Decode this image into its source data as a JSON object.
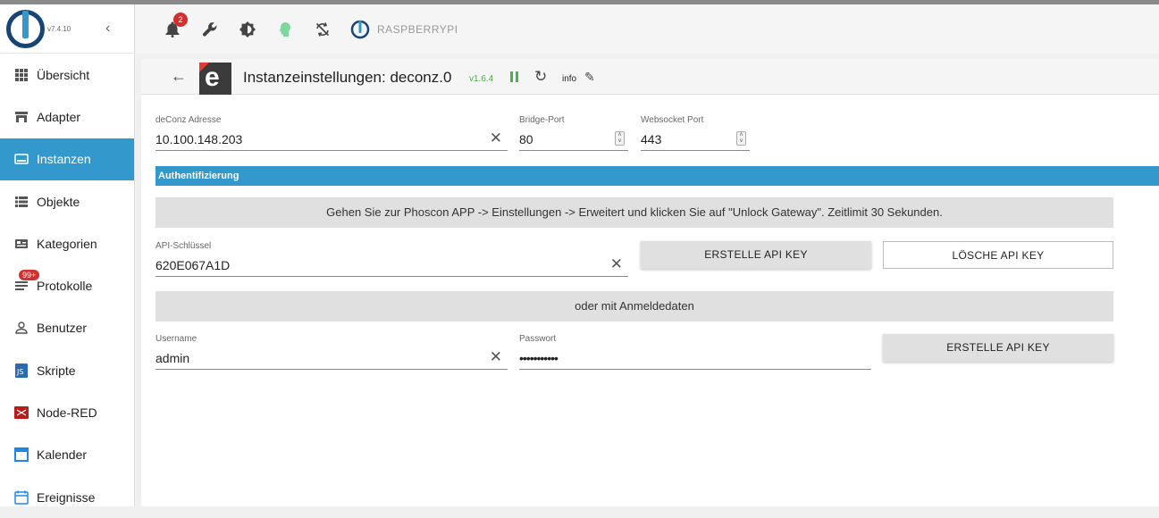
{
  "sidebar": {
    "version": "v7.4.10",
    "items": [
      {
        "label": "Übersicht"
      },
      {
        "label": "Adapter"
      },
      {
        "label": "Instanzen"
      },
      {
        "label": "Objekte"
      },
      {
        "label": "Kategorien"
      },
      {
        "label": "Protokolle",
        "badge": "99+"
      },
      {
        "label": "Benutzer"
      },
      {
        "label": "Skripte"
      },
      {
        "label": "Node-RED"
      },
      {
        "label": "Kalender"
      },
      {
        "label": "Ereignisse"
      }
    ]
  },
  "topbar": {
    "notification_count": "2",
    "host": "RASPBERRYPI"
  },
  "header": {
    "title": "Instanzeinstellungen: deconz.0",
    "version": "v1.6.4",
    "info": "info"
  },
  "form": {
    "address": {
      "label": "deConz Adresse",
      "value": "10.100.148.203"
    },
    "bridge_port": {
      "label": "Bridge-Port",
      "value": "80"
    },
    "websocket_port": {
      "label": "Websocket Port",
      "value": "443"
    },
    "section_title": "Authentifizierung",
    "notice": "Gehen Sie zur Phoscon APP -> Einstellungen -> Erweitert und klicken Sie auf \"Unlock Gateway\". Zeitlimit 30 Sekunden.",
    "api_key": {
      "label": "API-Schlüssel",
      "value": "620E067A1D"
    },
    "create_api_key": "ERSTELLE API KEY",
    "delete_api_key": "LÖSCHE API KEY",
    "alt_notice": "oder mit Anmeldedaten",
    "username": {
      "label": "Username",
      "value": "admin"
    },
    "password": {
      "label": "Passwort",
      "value": "•••••••••••"
    },
    "create_api_key_2": "ERSTELLE API KEY"
  }
}
